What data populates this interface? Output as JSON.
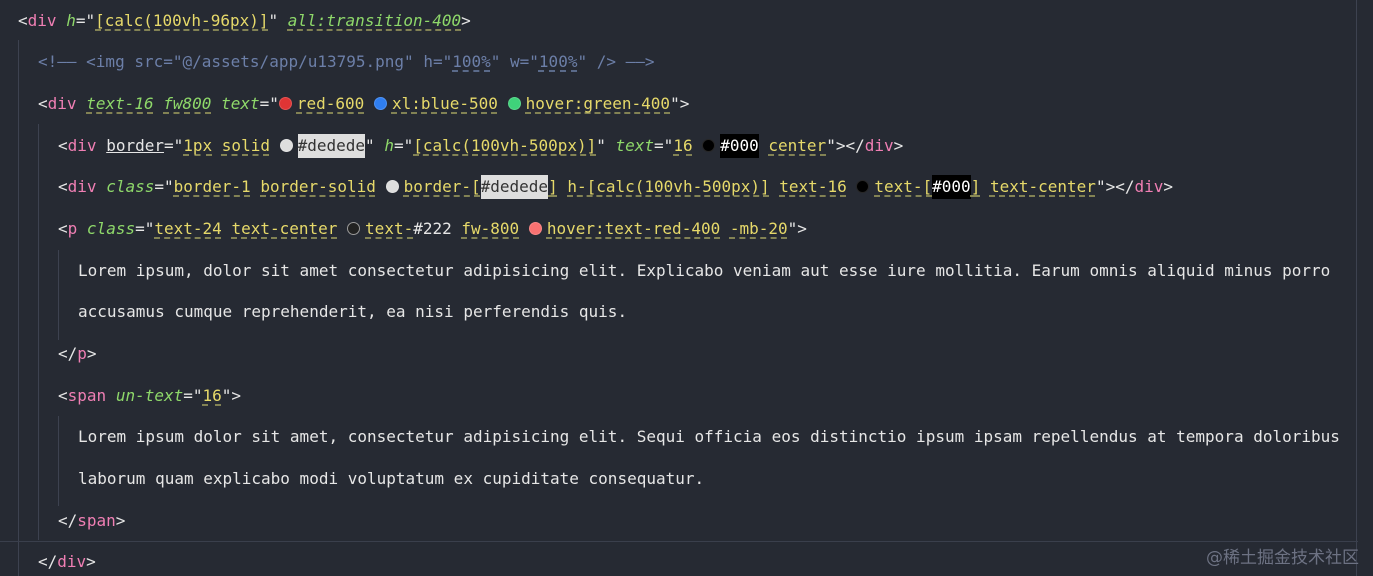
{
  "lines": [
    {
      "segs": [
        {
          "c": "t",
          "v": "<"
        },
        {
          "c": "tag",
          "v": "div"
        },
        {
          "c": "t",
          "v": " "
        },
        {
          "c": "attr",
          "v": "h"
        },
        {
          "c": "t",
          "v": "=\""
        },
        {
          "c": "str dash",
          "v": "[calc(100vh-96px)]"
        },
        {
          "c": "t",
          "v": "\" "
        },
        {
          "c": "attr dash",
          "v": "all:transition-400"
        },
        {
          "c": "t",
          "v": ">"
        }
      ]
    },
    {
      "segs": [
        {
          "c": "cmt",
          "v": "<!—— <img src=\"@/assets/app/u13795.png\" h=\""
        },
        {
          "c": "cmt cmt-u",
          "v": "100%"
        },
        {
          "c": "cmt",
          "v": "\" w=\""
        },
        {
          "c": "cmt cmt-u",
          "v": "100%"
        },
        {
          "c": "cmt",
          "v": "\" /> ——>"
        }
      ]
    },
    {
      "segs": [
        {
          "c": "t",
          "v": "<"
        },
        {
          "c": "tag",
          "v": "div"
        },
        {
          "c": "t",
          "v": " "
        },
        {
          "c": "attr dash",
          "v": "text-16"
        },
        {
          "c": "t",
          "v": " "
        },
        {
          "c": "attr dash",
          "v": "fw800"
        },
        {
          "c": "t",
          "v": " "
        },
        {
          "c": "attr",
          "v": "text"
        },
        {
          "c": "t",
          "v": "=\""
        },
        {
          "dot": "#e03535"
        },
        {
          "c": "str dash",
          "v": "red-600"
        },
        {
          "c": "t",
          "v": " "
        },
        {
          "dot": "#2f7ef0"
        },
        {
          "c": "str dash",
          "v": "xl:blue-500"
        },
        {
          "c": "t",
          "v": " "
        },
        {
          "dot": "#3fd27a"
        },
        {
          "c": "str dash",
          "v": "hover:green-400"
        },
        {
          "c": "t",
          "v": "\">"
        }
      ]
    },
    {
      "segs": [
        {
          "c": "t",
          "v": "<"
        },
        {
          "c": "tag",
          "v": "div"
        },
        {
          "c": "t",
          "v": " "
        },
        {
          "c": "t u",
          "v": "border"
        },
        {
          "c": "t",
          "v": "=\""
        },
        {
          "c": "str dash",
          "v": "1px"
        },
        {
          "c": "t",
          "v": " "
        },
        {
          "c": "str dash",
          "v": "solid"
        },
        {
          "c": "t",
          "v": " "
        },
        {
          "dot": "#dedede"
        },
        {
          "sw": "#dedede",
          "fg": "#333333",
          "v": "#dedede"
        },
        {
          "c": "t",
          "v": "\" "
        },
        {
          "c": "attr",
          "v": "h"
        },
        {
          "c": "t",
          "v": "=\""
        },
        {
          "c": "str dash",
          "v": "[calc(100vh-500px)]"
        },
        {
          "c": "t",
          "v": "\" "
        },
        {
          "c": "attr",
          "v": "text"
        },
        {
          "c": "t",
          "v": "=\""
        },
        {
          "c": "str dash",
          "v": "16"
        },
        {
          "c": "t",
          "v": " "
        },
        {
          "dot": "#000000"
        },
        {
          "sw": "#000000",
          "fg": "#ffffff",
          "v": "#000"
        },
        {
          "c": "t",
          "v": " "
        },
        {
          "c": "str dash",
          "v": "center"
        },
        {
          "c": "t",
          "v": "\"></"
        },
        {
          "c": "tag",
          "v": "div"
        },
        {
          "c": "t",
          "v": ">"
        }
      ]
    },
    {
      "segs": [
        {
          "c": "t",
          "v": "<"
        },
        {
          "c": "tag",
          "v": "div"
        },
        {
          "c": "t",
          "v": " "
        },
        {
          "c": "attr",
          "v": "class"
        },
        {
          "c": "t",
          "v": "=\""
        },
        {
          "c": "str dash",
          "v": "border-1"
        },
        {
          "c": "t",
          "v": " "
        },
        {
          "c": "str dash",
          "v": "border-solid"
        },
        {
          "c": "t",
          "v": " "
        },
        {
          "dot": "#dedede"
        },
        {
          "c": "str dash",
          "v": "border-["
        },
        {
          "sw": "#dedede",
          "fg": "#333333",
          "v": "#dedede"
        },
        {
          "c": "str dash",
          "v": "]"
        },
        {
          "c": "t",
          "v": " "
        },
        {
          "c": "str dash",
          "v": "h-[calc(100vh-500px)]"
        },
        {
          "c": "t",
          "v": " "
        },
        {
          "c": "str dash",
          "v": "text-16"
        },
        {
          "c": "t",
          "v": " "
        },
        {
          "dot": "#000000"
        },
        {
          "c": "str dash",
          "v": "text-["
        },
        {
          "sw": "#000000",
          "fg": "#ffffff",
          "v": "#000"
        },
        {
          "c": "str dash",
          "v": "]"
        },
        {
          "c": "t",
          "v": " "
        },
        {
          "c": "str dash",
          "v": "text-center"
        },
        {
          "c": "t",
          "v": "\"></"
        },
        {
          "c": "tag",
          "v": "div"
        },
        {
          "c": "t",
          "v": ">"
        }
      ]
    },
    {
      "segs": [
        {
          "c": "t",
          "v": "<"
        },
        {
          "c": "tag",
          "v": "p"
        },
        {
          "c": "t",
          "v": " "
        },
        {
          "c": "attr",
          "v": "class"
        },
        {
          "c": "t",
          "v": "=\""
        },
        {
          "c": "str dash",
          "v": "text-24"
        },
        {
          "c": "t",
          "v": " "
        },
        {
          "c": "str dash",
          "v": "text-center"
        },
        {
          "c": "t",
          "v": " "
        },
        {
          "dot": "#222222",
          "ring": "#9a9a9a"
        },
        {
          "c": "str dash",
          "v": "text-"
        },
        {
          "c": "t",
          "v": "#222"
        },
        {
          "c": "t",
          "v": " "
        },
        {
          "c": "str dash",
          "v": "fw-800"
        },
        {
          "c": "t",
          "v": " "
        },
        {
          "dot": "#f87171"
        },
        {
          "c": "str dash",
          "v": "hover:text-red-400"
        },
        {
          "c": "t",
          "v": " "
        },
        {
          "c": "str dash",
          "v": "-mb-20"
        },
        {
          "c": "t",
          "v": "\">"
        }
      ]
    },
    {
      "segs": [
        {
          "c": "txt",
          "v": "Lorem ipsum, dolor sit amet consectetur adipisicing elit. Explicabo veniam aut esse iure mollitia. Earum omnis aliquid minus porro"
        }
      ]
    },
    {
      "segs": [
        {
          "c": "txt",
          "v": "accusamus cumque reprehenderit, ea nisi perferendis quis."
        }
      ]
    },
    {
      "segs": [
        {
          "c": "t",
          "v": "</"
        },
        {
          "c": "tag",
          "v": "p"
        },
        {
          "c": "t",
          "v": ">"
        }
      ]
    },
    {
      "segs": [
        {
          "c": "t",
          "v": "<"
        },
        {
          "c": "tag",
          "v": "span"
        },
        {
          "c": "t",
          "v": " "
        },
        {
          "c": "attr",
          "v": "un-text"
        },
        {
          "c": "t",
          "v": "=\""
        },
        {
          "c": "str dash",
          "v": "16"
        },
        {
          "c": "t",
          "v": "\">"
        }
      ]
    },
    {
      "segs": [
        {
          "c": "txt",
          "v": "Lorem ipsum dolor sit amet, consectetur adipisicing elit. Sequi officia eos distinctio ipsum ipsam repellendus at tempora doloribus"
        }
      ]
    },
    {
      "segs": [
        {
          "c": "txt",
          "v": "laborum quam explicabo modi voluptatum ex cupiditate consequatur."
        }
      ]
    },
    {
      "segs": [
        {
          "c": "t",
          "v": "</"
        },
        {
          "c": "tag",
          "v": "span"
        },
        {
          "c": "t",
          "v": ">"
        }
      ]
    },
    {
      "segs": [
        {
          "c": "t",
          "v": "</"
        },
        {
          "c": "tag",
          "v": "div"
        },
        {
          "c": "t",
          "v": ">"
        }
      ]
    }
  ],
  "watermark": "@稀土掘金技术社区"
}
